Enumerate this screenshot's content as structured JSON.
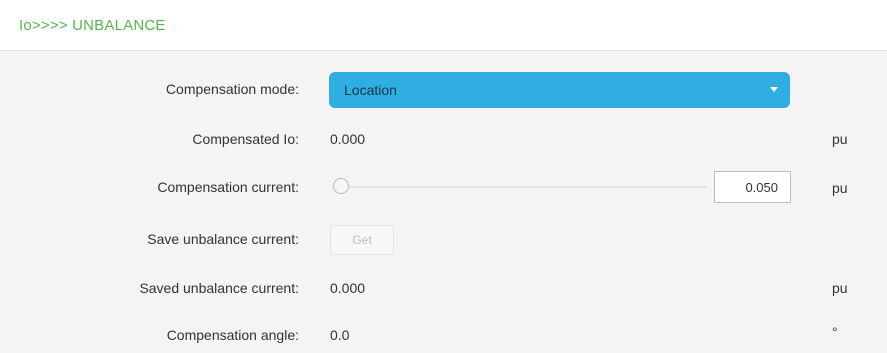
{
  "header": {
    "title": "Io>>>> UNBALANCE"
  },
  "form": {
    "compensation_mode": {
      "label": "Compensation mode:",
      "value": "Location"
    },
    "compensated_io": {
      "label": "Compensated Io:",
      "value": "0.000",
      "unit": "pu"
    },
    "compensation_current": {
      "label": "Compensation current:",
      "value": "0.050",
      "unit": "pu",
      "slider_level": 0
    },
    "save_unbalance_current": {
      "label": "Save unbalance current:",
      "button_label": "Get"
    },
    "saved_unbalance_current": {
      "label": "Saved unbalance current:",
      "value": "0.000",
      "unit": "pu"
    },
    "compensation_angle": {
      "label": "Compensation angle:",
      "value": "0.0",
      "unit": "°"
    }
  },
  "colors": {
    "accent": "#2eaee1",
    "header_title": "#59b34f",
    "background": "#f4f4f4"
  },
  "icons": {
    "select_caret": "chevron-down-icon"
  }
}
